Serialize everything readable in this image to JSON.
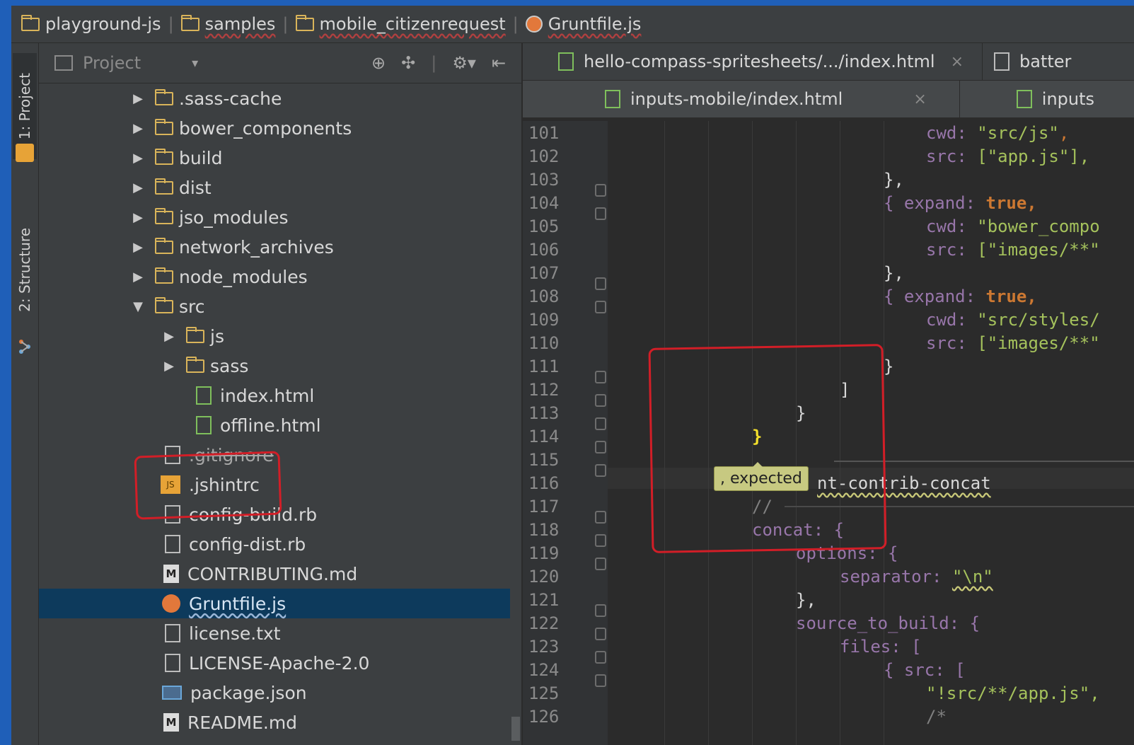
{
  "breadcrumb": {
    "items": [
      {
        "label": "playground-js",
        "icon": "folder-icon"
      },
      {
        "label": "samples",
        "icon": "folder-icon"
      },
      {
        "label": "mobile_citizenrequest",
        "icon": "folder-icon"
      },
      {
        "label": "Gruntfile.js",
        "icon": "grunt-icon"
      }
    ]
  },
  "toolstrip": {
    "project_tab": "1: Project",
    "structure_tab": "2: Structure"
  },
  "project_panel": {
    "title": "Project",
    "tools": [
      "target-icon",
      "split-icon",
      "gear-icon",
      "pin-icon"
    ],
    "tree": [
      {
        "label": ".sass-cache",
        "type": "folder",
        "expanded": false
      },
      {
        "label": "bower_components",
        "type": "folder",
        "expanded": false
      },
      {
        "label": "build",
        "type": "folder",
        "expanded": false
      },
      {
        "label": "dist",
        "type": "folder",
        "expanded": false
      },
      {
        "label": "jso_modules",
        "type": "folder",
        "expanded": false
      },
      {
        "label": "network_archives",
        "type": "folder",
        "expanded": false
      },
      {
        "label": "node_modules",
        "type": "folder",
        "expanded": false
      },
      {
        "label": "src",
        "type": "folder",
        "expanded": true
      },
      {
        "label": "js",
        "type": "folder",
        "expanded": false
      },
      {
        "label": "sass",
        "type": "folder",
        "expanded": false
      },
      {
        "label": "index.html",
        "type": "html"
      },
      {
        "label": "offline.html",
        "type": "html"
      },
      {
        "label": ".gitignore",
        "type": "text"
      },
      {
        "label": ".jshintrc",
        "type": "js"
      },
      {
        "label": "config-build.rb",
        "type": "text"
      },
      {
        "label": "config-dist.rb",
        "type": "text"
      },
      {
        "label": "CONTRIBUTING.md",
        "type": "md"
      },
      {
        "label": "Gruntfile.js",
        "type": "grunt",
        "selected": true
      },
      {
        "label": "license.txt",
        "type": "text"
      },
      {
        "label": "LICENSE-Apache-2.0",
        "type": "text"
      },
      {
        "label": "package.json",
        "type": "json"
      },
      {
        "label": "README.md",
        "type": "md"
      }
    ]
  },
  "editor": {
    "tabs_row1": [
      {
        "label": "hello-compass-spritesheets/.../index.html",
        "close": "×"
      },
      {
        "label": "batter"
      }
    ],
    "tabs_row2": [
      {
        "label": "inputs-mobile/index.html",
        "close": "×"
      },
      {
        "label": "inputs"
      }
    ],
    "line_numbers": [
      "101",
      "102",
      "103",
      "104",
      "105",
      "106",
      "107",
      "108",
      "109",
      "110",
      "111",
      "112",
      "113",
      "114",
      "115",
      "116",
      "117",
      "118",
      "119",
      "120",
      "121",
      "122",
      "123",
      "124",
      "125",
      "126"
    ],
    "tooltip": ", expected",
    "code": {
      "l101_key": "cwd:",
      "l101_val": "\"src/js\"",
      "l102_key": "src:",
      "l102_val": "[\"app.js\"],",
      "l103": "},",
      "l104_key": "{ expand:",
      "l104_val": "true,",
      "l105_key": "cwd:",
      "l105_val": "\"bower_compo",
      "l106_key": "src:",
      "l106_val": "[\"images/**\"",
      "l107": "},",
      "l108_key": "{ expand:",
      "l108_val": "true,",
      "l109_key": "cwd:",
      "l109_val": "\"src/styles/",
      "l110_key": "src:",
      "l110_val": "[\"images/**\"",
      "l111": "}",
      "l112": "]",
      "l113": "}",
      "l114": "}",
      "l116": "nt-contrib-concat",
      "l117": "//",
      "l118": "concat: {",
      "l119": "options: {",
      "l120_key": "separator:",
      "l120_val": "\"\\n\"",
      "l121": "},",
      "l122": "source_to_build: {",
      "l123": "files: [",
      "l124": "{ src: [",
      "l125": "\"!src/**/app.js\",",
      "l126": "/*"
    }
  }
}
